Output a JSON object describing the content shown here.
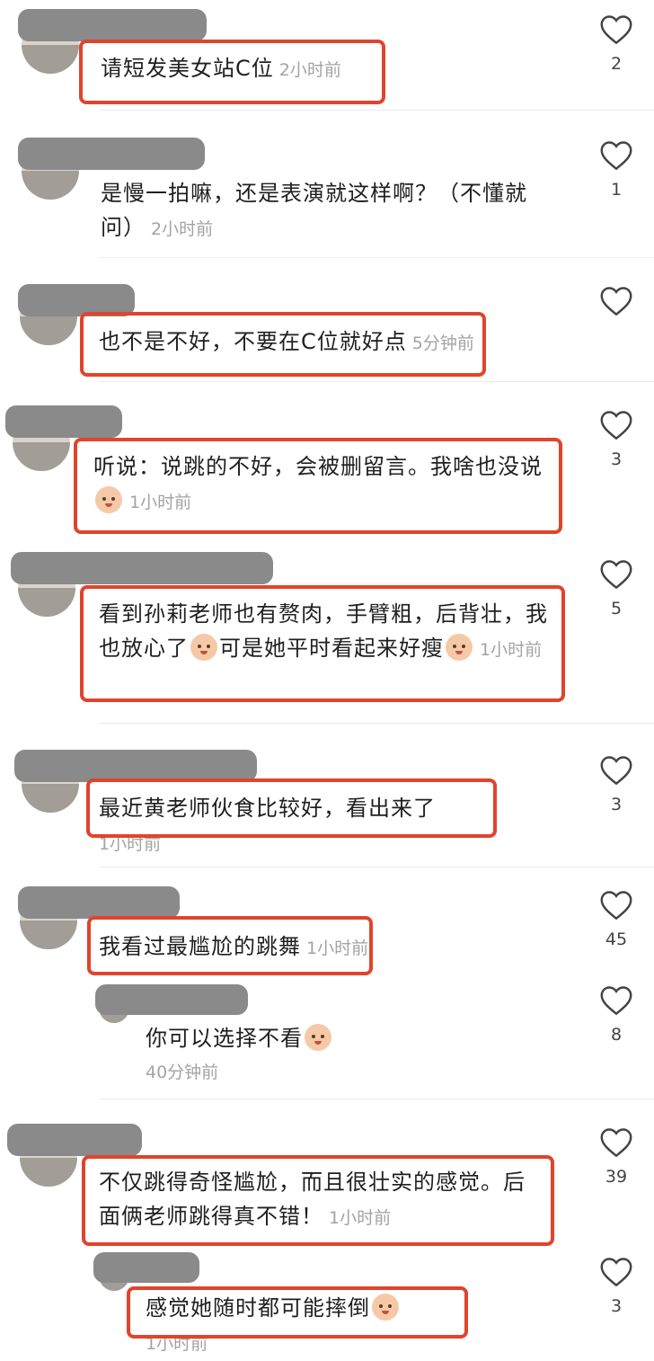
{
  "comments": [
    {
      "text": "请短发美女站C位",
      "time": "2小时前",
      "likes": "2"
    },
    {
      "text": "是慢一拍嘛，还是表演就这样啊？（不懂就问）",
      "time": "2小时前",
      "likes": "1"
    },
    {
      "text": "也不是不好，不要在C位就好点",
      "time": "5分钟前",
      "likes": ""
    },
    {
      "text": "听说：说跳的不好，会被删留言。我啥也没说",
      "time": "1小时前",
      "likes": "3"
    },
    {
      "text": "看到孙莉老师也有赘肉，手臂粗，后背壮，我也放心了",
      "text2": "可是她平时看起来好瘦",
      "time": "1小时前",
      "likes": "5"
    },
    {
      "text": "最近黄老师伙食比较好，看出来了",
      "time": "1小时前",
      "likes": "3"
    },
    {
      "text": "我看过最尴尬的跳舞",
      "time": "1小时前",
      "likes": "45"
    },
    {
      "text": "你可以选择不看",
      "time": "40分钟前",
      "likes": "8"
    },
    {
      "text": "不仅跳得奇怪尴尬，而且很壮实的感觉。后面俩老师跳得真不错！",
      "time": "1小时前",
      "likes": "39"
    },
    {
      "text": "感觉她随时都可能摔倒",
      "time": "1小时前",
      "likes": "3"
    }
  ],
  "icons": {
    "like": "heart-outline-icon",
    "emoji": "emoji-face-icon"
  },
  "colors": {
    "highlight_box": "#e0442c",
    "timestamp": "#a3a3a3",
    "text": "#1f1f1f"
  }
}
